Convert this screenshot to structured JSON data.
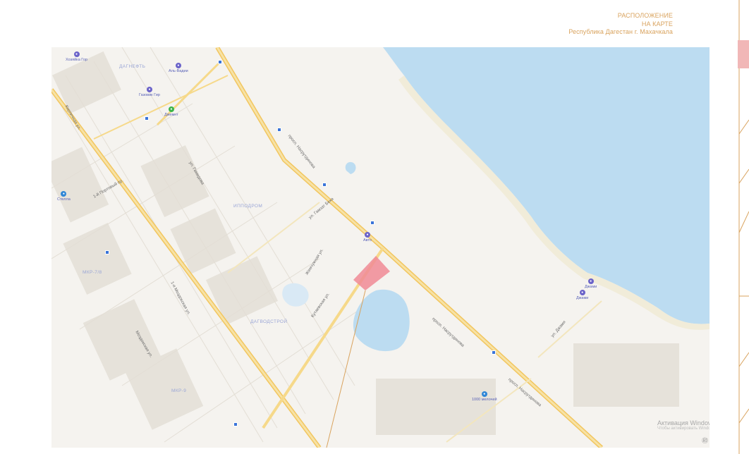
{
  "header": {
    "title_line1": "РАСПОЛОЖЕНИЕ",
    "title_line2": "НА КАРТЕ",
    "location": "Республика Дагестан г. Махачкала"
  },
  "colors": {
    "accent": "#d9a35e",
    "water": "#bcdcf1",
    "road": "#f6d98a",
    "plot": "#f08a95",
    "land": "#f5f3ef"
  },
  "map": {
    "districts": [
      "ДАГНЕФТЬ",
      "ИППОДРОМ",
      "МКР-7/8",
      "ДАГВОДСТРОЙ",
      "МКР-9"
    ],
    "streets": [
      "просп. Насрутдинова",
      "просп. Насрутдинова",
      "просп. Насрутдинова",
      "ул. Гамзат Бека",
      "Кутаевская ул.",
      "1-я Моздокская ул.",
      "Жемчужная ул.",
      "ул. Джами",
      "ул. Гамидова",
      "1-й Портовый пр.",
      "Кирпичная ул.",
      "Моздокская ул."
    ],
    "pois": [
      {
        "label": "Хозяйка Гор",
        "icon": "store-icon"
      },
      {
        "label": "Аль-Вадии",
        "icon": "hotel-icon"
      },
      {
        "label": "Газовик Гир",
        "icon": "store-icon"
      },
      {
        "label": "Джемнт",
        "icon": "park-icon"
      },
      {
        "label": "Стелла",
        "icon": "gas-station-icon"
      },
      {
        "label": "Авто",
        "icon": "car-icon"
      },
      {
        "label": "Джами",
        "icon": "mosque-icon"
      },
      {
        "label": "Джами",
        "icon": "mosque-icon"
      },
      {
        "label": "1000 мелочей",
        "icon": "shop-icon"
      }
    ],
    "watermark": "Активация Windows",
    "watermark_sub": "Чтобы активировать Windows",
    "copyright_mark": "㊞"
  }
}
